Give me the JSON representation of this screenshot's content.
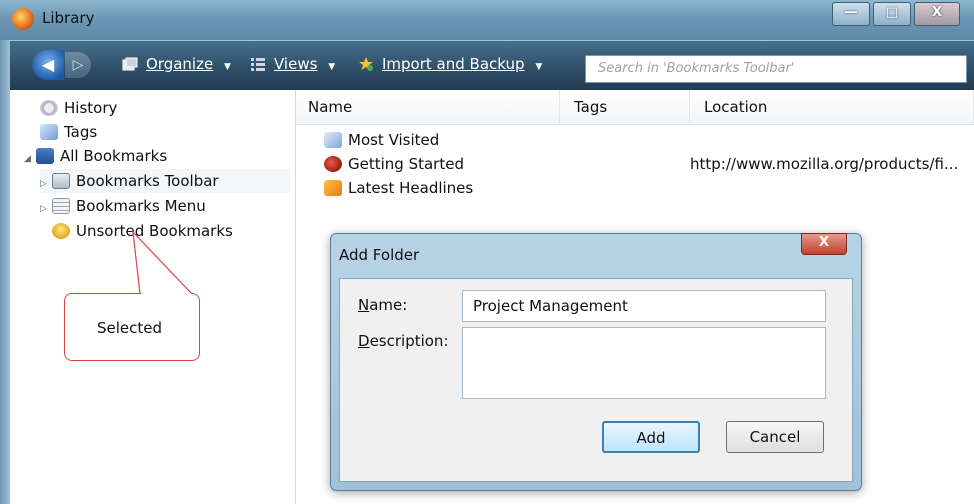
{
  "window": {
    "title": "Library",
    "min_glyph": "—",
    "max_glyph": "□",
    "close_glyph": "X"
  },
  "toolbar": {
    "back_glyph": "◀",
    "forward_glyph": "▷",
    "organize_label": "Organize",
    "views_label": "Views",
    "import_label": "Import and Backup",
    "dropdown_glyph": "▼",
    "search_placeholder": "Search in 'Bookmarks Toolbar'"
  },
  "sidebar": {
    "items": [
      {
        "label": "History",
        "icon": "history-icon"
      },
      {
        "label": "Tags",
        "icon": "tags-icon"
      },
      {
        "label": "All Bookmarks",
        "icon": "all-bookmarks-icon"
      },
      {
        "label": "Bookmarks Toolbar",
        "icon": "bookmarks-toolbar-icon"
      },
      {
        "label": "Bookmarks Menu",
        "icon": "bookmarks-menu-icon"
      },
      {
        "label": "Unsorted Bookmarks",
        "icon": "unsorted-bookmarks-icon"
      }
    ],
    "expanded_glyph": "◢",
    "collapsed_glyph": "▷"
  },
  "table": {
    "columns": [
      "Name",
      "Tags",
      "Location"
    ],
    "rows": [
      {
        "name": "Most Visited",
        "tags": "",
        "location": "",
        "icon": "smart-folder-icon"
      },
      {
        "name": "Getting Started",
        "tags": "",
        "location": "http://www.mozilla.org/products/fi...",
        "icon": "firefox-bookmark-icon"
      },
      {
        "name": "Latest Headlines",
        "tags": "",
        "location": "",
        "icon": "rss-feed-icon"
      }
    ]
  },
  "dialog": {
    "title": "Add Folder",
    "close_glyph": "X",
    "name_label_key": "N",
    "name_label_rest": "ame:",
    "name_value": "Project Management",
    "description_label_key": "D",
    "description_label_rest": "escription:",
    "description_value": "",
    "add_label": "Add",
    "cancel_label": "Cancel"
  },
  "callout": {
    "text": "Selected"
  },
  "colors": {
    "toolbar_bg": "#2f4f68",
    "callout_border": "#dd4444",
    "dialog_bg": "#b8d3e6"
  }
}
